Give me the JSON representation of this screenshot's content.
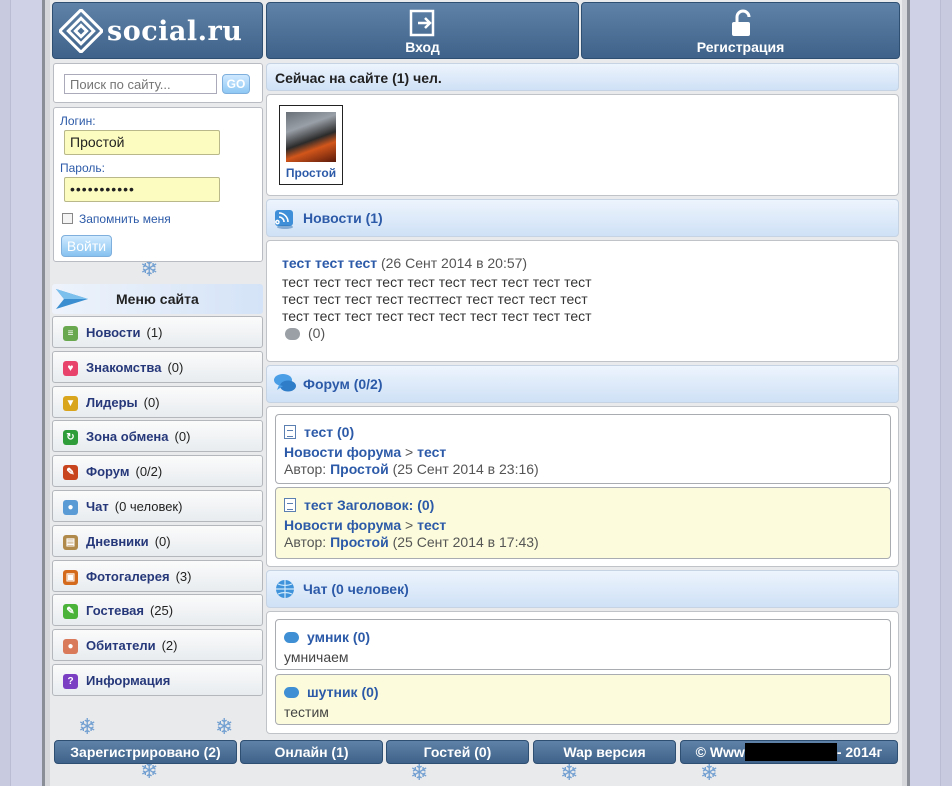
{
  "header": {
    "logo_text": "social.ru",
    "login_label": "Вход",
    "register_label": "Регистрация"
  },
  "search": {
    "placeholder": "Поиск по сайту...",
    "go_label": "GO"
  },
  "login_form": {
    "login_label": "Логин:",
    "login_value": "Простой",
    "password_label": "Пароль:",
    "password_value": "•••••••••••",
    "remember_label": "Запомнить меня",
    "submit_label": "Войти"
  },
  "menu": {
    "title": "Меню сайта",
    "items": [
      {
        "label": "Новости",
        "count": "(1)",
        "icon": "news-icon",
        "color": "#6aa84f"
      },
      {
        "label": "Знакомства",
        "count": "(0)",
        "icon": "heart-icon",
        "color": "#e8436b"
      },
      {
        "label": "Лидеры",
        "count": "(0)",
        "icon": "trophy-icon",
        "color": "#d9a51c"
      },
      {
        "label": "Зона обмена",
        "count": "(0)",
        "icon": "exchange-icon",
        "color": "#2f9e3a"
      },
      {
        "label": "Форум",
        "count": "(0/2)",
        "icon": "pencil-icon",
        "color": "#c8441c"
      },
      {
        "label": "Чат",
        "count": "(0 человек)",
        "icon": "chat-icon",
        "color": "#5b9bd5"
      },
      {
        "label": "Дневники",
        "count": "(0)",
        "icon": "clipboard-icon",
        "color": "#b08a4a"
      },
      {
        "label": "Фотогалерея",
        "count": "(3)",
        "icon": "photo-icon",
        "color": "#d46a1c"
      },
      {
        "label": "Гостевая",
        "count": "(25)",
        "icon": "guestbook-icon",
        "color": "#4cb33a"
      },
      {
        "label": "Обитатели",
        "count": "(2)",
        "icon": "users-icon",
        "color": "#d97a5a"
      },
      {
        "label": "Информация",
        "count": "",
        "icon": "info-icon",
        "color": "#7b3fc4"
      }
    ]
  },
  "online": {
    "title": "Сейчас на сайте (1) чел.",
    "user_name": "Простой"
  },
  "news": {
    "title": "Новости (1)",
    "item_title": "тест тест тест",
    "item_date": "(26 Сент 2014 в 20:57)",
    "body_lines": [
      "тест тест тест тест тест тест тест тест тест тест",
      "тест тест тест тест тесттест тест тест тест тест",
      "тест тест тест тест тест тест тест тест тест тест"
    ],
    "comments": "(0)"
  },
  "forum": {
    "title": "Форум (0/2)",
    "topics": [
      {
        "title": "тест (0)",
        "section": "Новости форума",
        "subsection": "тест",
        "author_label": "Автор:",
        "author": "Простой",
        "date": "(25 Сент 2014 в 23:16)",
        "bg": "#ffffff"
      },
      {
        "title": "тест Заголовок: (0)",
        "section": "Новости форума",
        "subsection": "тест",
        "author_label": "Автор:",
        "author": "Простой",
        "date": "(25 Сент 2014 в 17:43)",
        "bg": "#fcfcdc"
      }
    ],
    "separator": ">"
  },
  "chat": {
    "title": "Чат (0 человек)",
    "rooms": [
      {
        "name": "умник (0)",
        "desc": "умничаем",
        "bg": "#ffffff"
      },
      {
        "name": "шутник (0)",
        "desc": "тестим",
        "bg": "#fcfcdc"
      }
    ]
  },
  "footer": {
    "registered": "Зарегистрировано (2)",
    "online": "Онлайн (1)",
    "guests": "Гостей (0)",
    "wap": "Wap версия",
    "copyright_prefix": "© Www",
    "copyright_suffix": "- 2014г"
  }
}
